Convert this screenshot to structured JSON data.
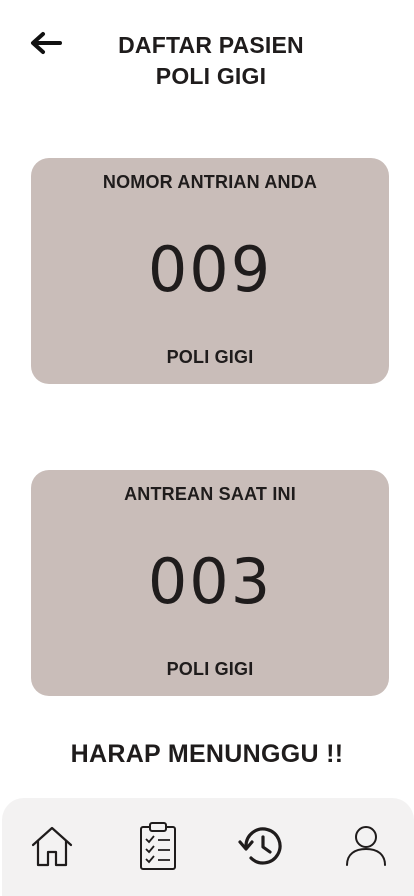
{
  "header": {
    "back_icon": "arrow-left-icon",
    "title_line1": "DAFTAR PASIEN",
    "title_line2": "POLI GIGI"
  },
  "my_queue": {
    "label": "NOMOR ANTRIAN ANDA",
    "number": "009",
    "clinic": "POLI GIGI"
  },
  "current_queue": {
    "label": "ANTREAN SAAT INI",
    "number": "003",
    "clinic": "POLI GIGI"
  },
  "message": "HARAP MENUNGGU !!",
  "bottom_nav": {
    "items": [
      "home-icon",
      "clipboard-list-icon",
      "history-icon",
      "user-icon"
    ]
  },
  "colors": {
    "card_background": "#c9bdb9",
    "nav_background": "#f3f2f2",
    "text": "#1f1c1c"
  }
}
